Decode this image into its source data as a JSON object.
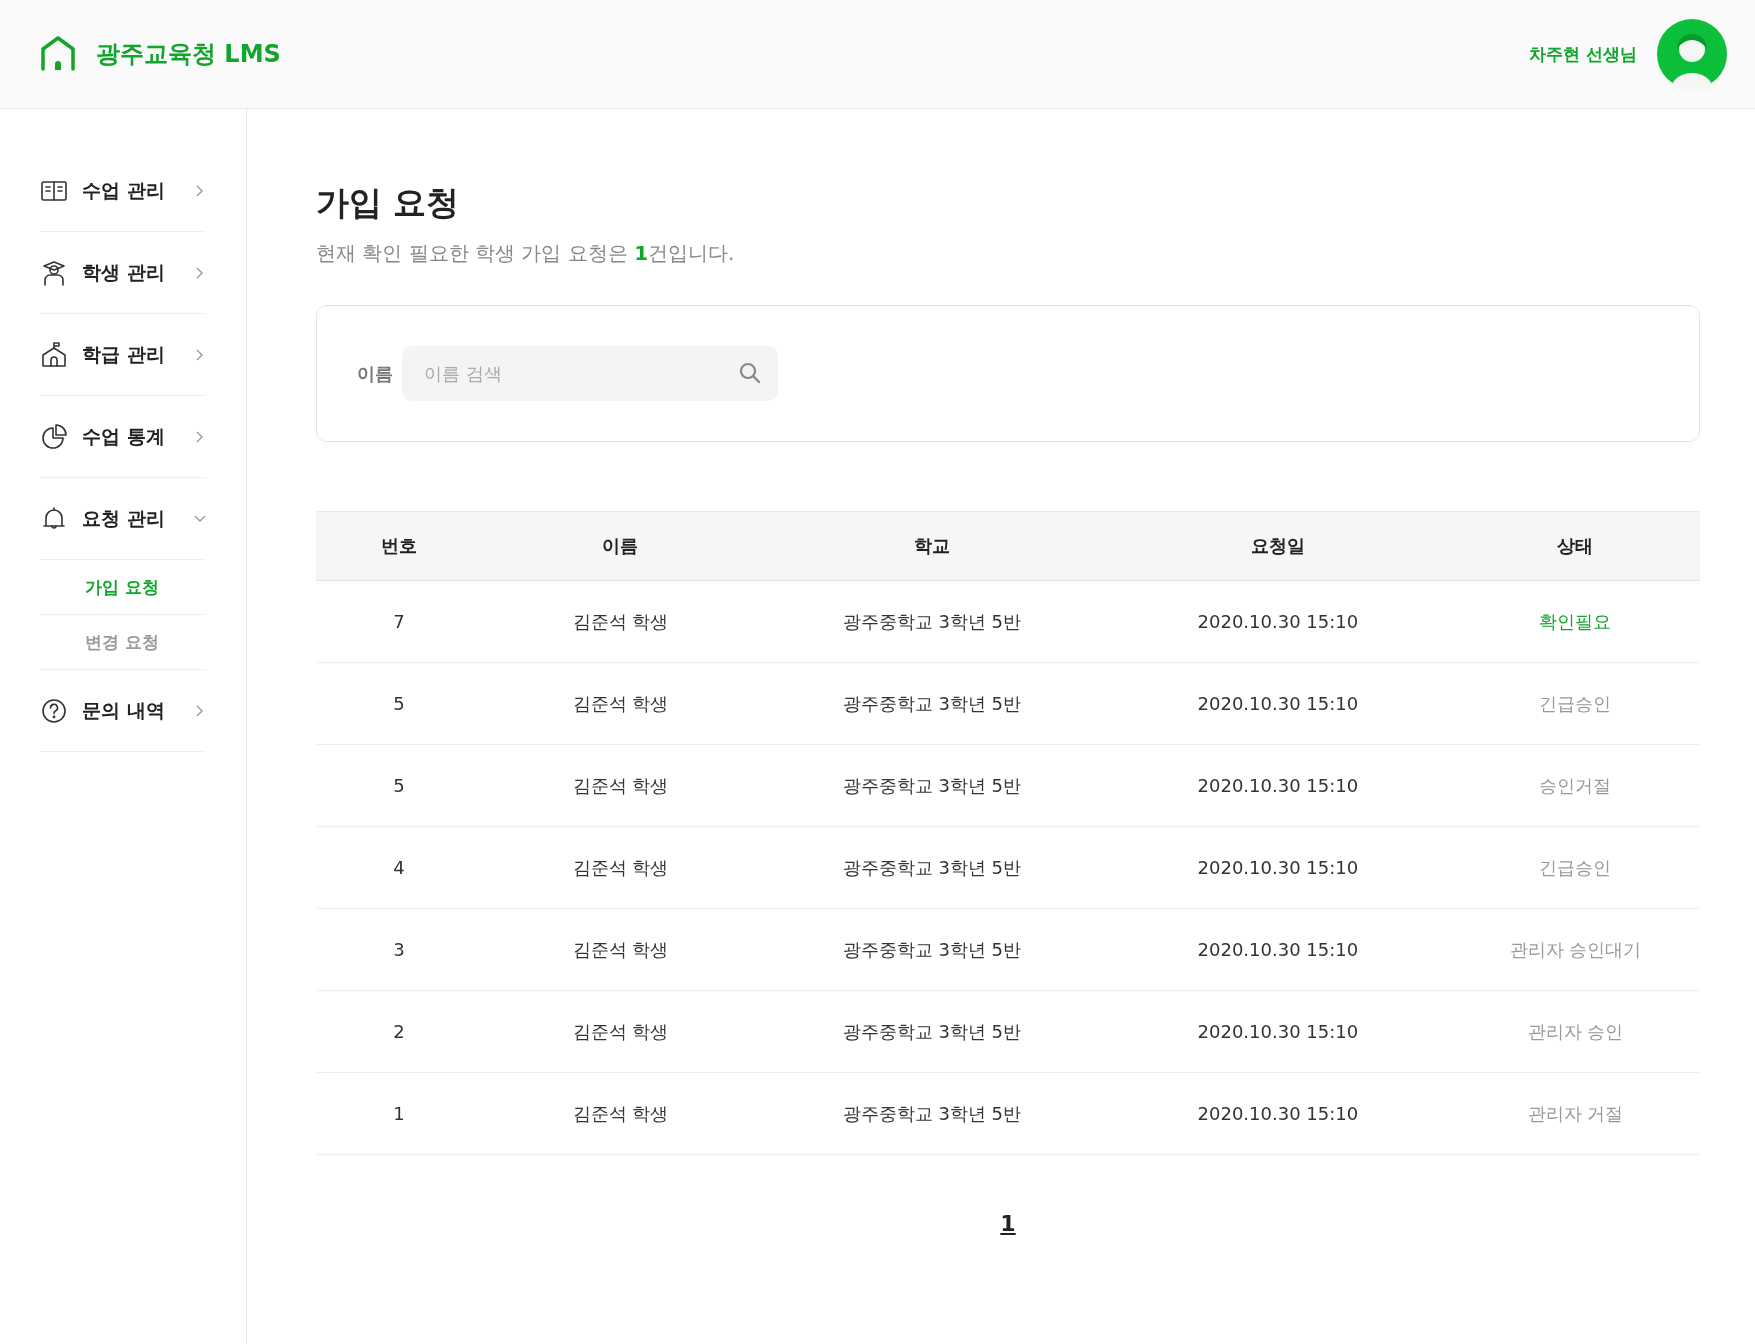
{
  "header": {
    "logo": "광주교육청 LMS",
    "user_name": "차주현 선생님"
  },
  "sidebar": {
    "items": [
      {
        "label": "수업 관리",
        "kind": "book",
        "expanded": false
      },
      {
        "label": "학생 관리",
        "kind": "student",
        "expanded": false
      },
      {
        "label": "학급 관리",
        "kind": "school",
        "expanded": false
      },
      {
        "label": "수업 통계",
        "kind": "chart",
        "expanded": false
      },
      {
        "label": "요청 관리",
        "kind": "bell",
        "expanded": true,
        "children": [
          {
            "label": "가입 요청",
            "selected": true
          },
          {
            "label": "변경 요청",
            "selected": false
          }
        ]
      },
      {
        "label": "문의 내역",
        "kind": "question",
        "expanded": false
      }
    ]
  },
  "page": {
    "title": "가입 요청",
    "subtitle": "현재 확인 필요한 학생 가입 요청은 **1**건입니다."
  },
  "search": {
    "label": "이름",
    "placeholder": "이름 검색"
  },
  "table": {
    "columns": [
      "번호",
      "이름",
      "학교",
      "요청일",
      "상태"
    ],
    "rows": [
      {
        "number": "7",
        "name": "김준석 학생",
        "school": "광주중학교 3학년 5반",
        "date": "2020.10.30 15:10",
        "status": "확인필요",
        "needs_action": true
      },
      {
        "number": "5",
        "name": "김준석 학생",
        "school": "광주중학교 3학년 5반",
        "date": "2020.10.30 15:10",
        "status": "긴급승인",
        "needs_action": false
      },
      {
        "number": "5",
        "name": "김준석 학생",
        "school": "광주중학교 3학년 5반",
        "date": "2020.10.30 15:10",
        "status": "승인거절",
        "needs_action": false
      },
      {
        "number": "4",
        "name": "김준석 학생",
        "school": "광주중학교 3학년 5반",
        "date": "2020.10.30 15:10",
        "status": "긴급승인",
        "needs_action": false
      },
      {
        "number": "3",
        "name": "김준석 학생",
        "school": "광주중학교 3학년 5반",
        "date": "2020.10.30 15:10",
        "status": "관리자 승인대기",
        "needs_action": false
      },
      {
        "number": "2",
        "name": "김준석 학생",
        "school": "광주중학교 3학년 5반",
        "date": "2020.10.30 15:10",
        "status": "관리자 승인",
        "needs_action": false
      },
      {
        "number": "1",
        "name": "김준석 학생",
        "school": "광주중학교 3학년 5반",
        "date": "2020.10.30 15:10",
        "status": "관리자 거절",
        "needs_action": false
      }
    ]
  },
  "pagination": {
    "pages": [
      {
        "label": "1",
        "selected": true
      }
    ]
  }
}
